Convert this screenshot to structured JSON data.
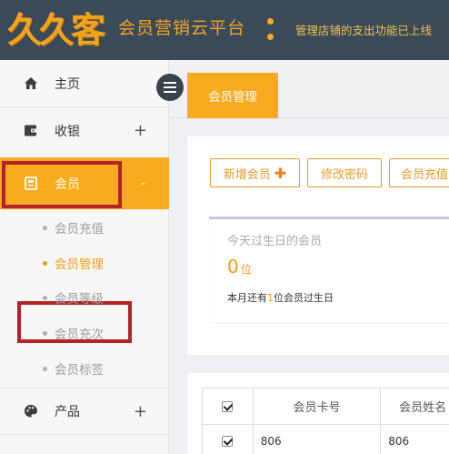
{
  "header": {
    "logo_text": "久久客",
    "platform_title": "会员营销云平台",
    "notice": "管理店铺的支出功能已上线"
  },
  "sidebar": {
    "items": [
      {
        "label": "主页",
        "icon": "home-icon"
      },
      {
        "label": "收银",
        "icon": "wallet-icon",
        "expand": "+"
      },
      {
        "label": "会员",
        "icon": "member-card-icon",
        "expand": "-"
      },
      {
        "label": "产品",
        "icon": "palette-icon",
        "expand": "+"
      }
    ],
    "member_sub_items": [
      "会员充值",
      "会员管理",
      "会员等级",
      "会员充次",
      "会员标签"
    ],
    "active_sub_item": "会员管理"
  },
  "tabs": {
    "active": "会员管理"
  },
  "toolbar": {
    "add_member_label": "新增会员",
    "add_icon": "plus-icon",
    "change_password_label": "修改密码",
    "recharge_label": "会员充值"
  },
  "birthday_panel": {
    "title": "今天过生日的会员",
    "count": "0",
    "count_unit": "位",
    "note_prefix": "本月还有",
    "note_count": "1",
    "note_suffix": "位会员过生日"
  },
  "member_table": {
    "columns": [
      "会员卡号",
      "会员姓名"
    ],
    "rows": [
      {
        "card_no": "806",
        "name": "806",
        "checked": true
      }
    ]
  },
  "colors": {
    "accent": "#f8ab1e",
    "header_bg": "#3a4a59",
    "annotation_red": "#b4222a"
  }
}
